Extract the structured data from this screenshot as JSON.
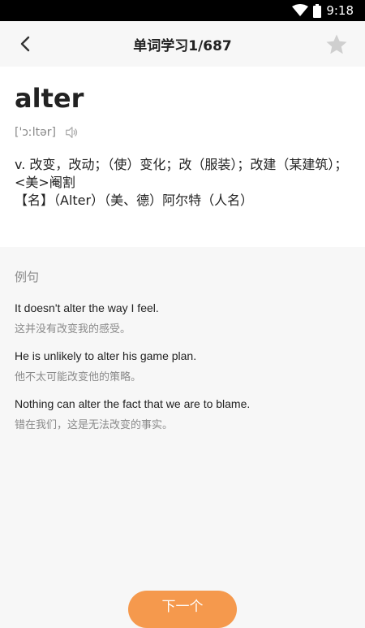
{
  "status_bar": {
    "time": "9:18",
    "wifi_icon": "wifi-icon",
    "battery_icon": "battery-icon"
  },
  "header": {
    "title": "单词学习1/687",
    "back_icon": "chevron-left-icon",
    "favorite_icon": "star-icon"
  },
  "word": {
    "headword": "alter",
    "phonetic": "['ɔːltər]",
    "speaker_icon": "speaker-icon",
    "definition_line1": "v. 改变，改动；（使）变化；改（服装）；改建（某建筑）；<美>阉割",
    "definition_line2": "【名】（Alter）（美、德）阿尔特（人名）"
  },
  "examples": {
    "heading": "例句",
    "items": [
      {
        "en": "It doesn't alter the way I feel.",
        "zh": "这并没有改变我的感受。"
      },
      {
        "en": "He is unlikely to alter his game plan.",
        "zh": "他不太可能改变他的策略。"
      },
      {
        "en": "Nothing can alter the fact that we are to blame.",
        "zh": "错在我们，这是无法改变的事实。"
      }
    ]
  },
  "bottom_button": {
    "label": "下一个"
  },
  "colors": {
    "accent": "#f5994d",
    "background": "#f7f7f7",
    "card": "#ffffff",
    "secondary_text": "#8a8a8a"
  }
}
